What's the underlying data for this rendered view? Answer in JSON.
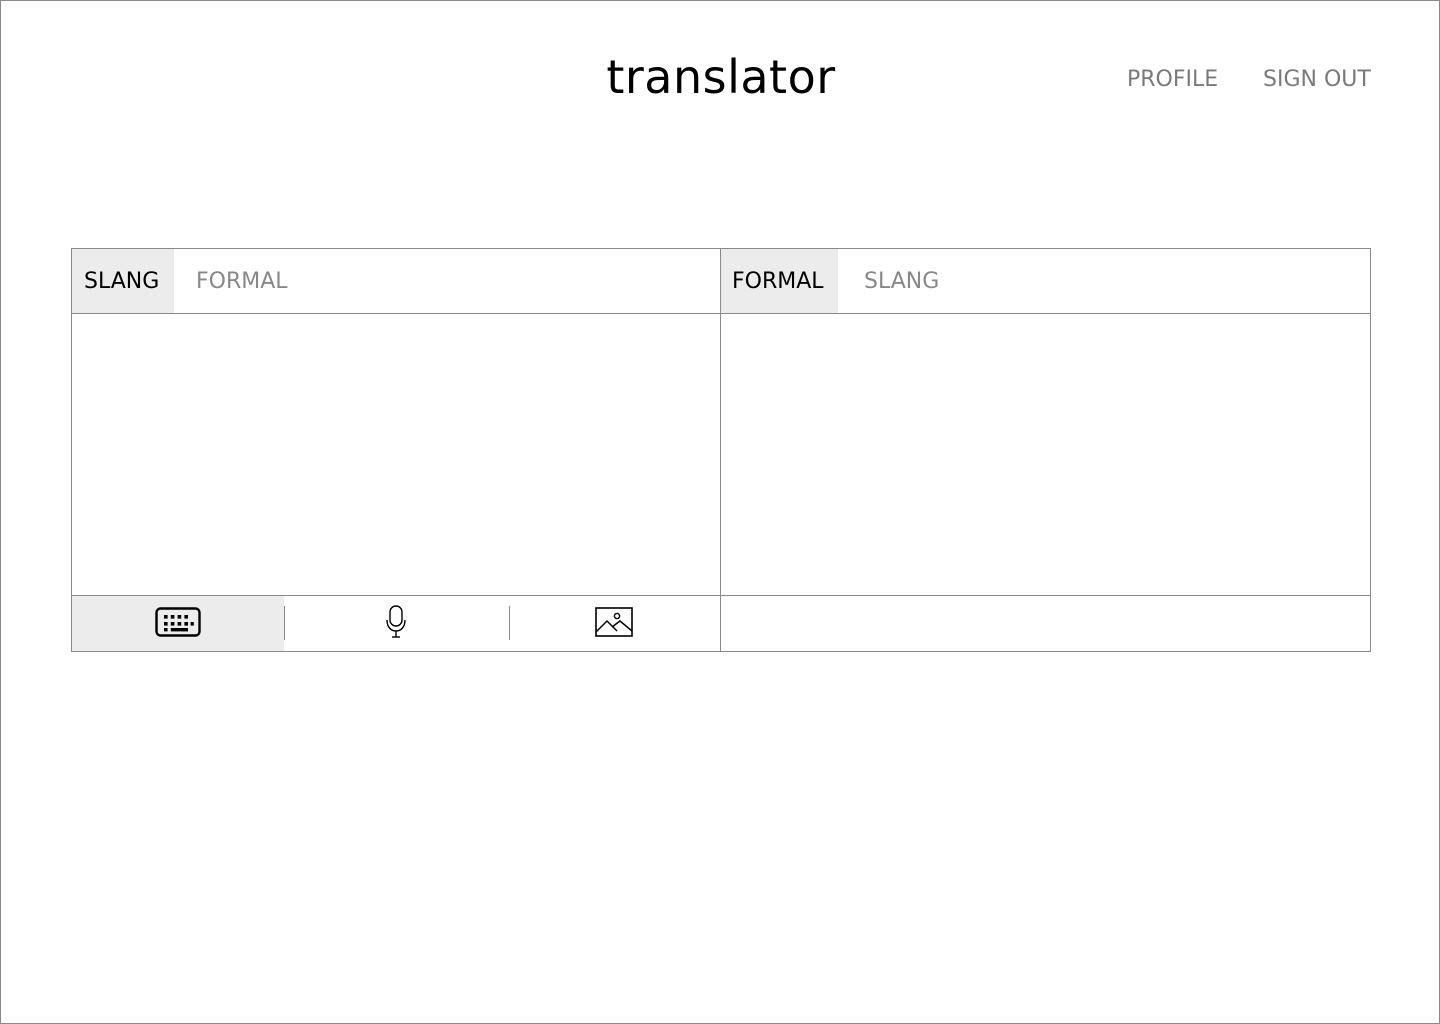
{
  "header": {
    "title": "translator",
    "nav": {
      "profile": "PROFILE",
      "sign_out": "SIGN OUT"
    }
  },
  "source": {
    "tabs": {
      "active": "SLANG",
      "inactive": "FORMAL"
    },
    "text_value": "",
    "input_modes": [
      {
        "name": "keyboard-icon",
        "selected": true
      },
      {
        "name": "microphone-icon",
        "selected": false
      },
      {
        "name": "image-icon",
        "selected": false
      }
    ]
  },
  "target": {
    "tabs": {
      "active": "FORMAL",
      "inactive": "SLANG"
    },
    "text_value": ""
  },
  "colors": {
    "border": "#8a8a8a",
    "active_tab_bg": "#ececec",
    "inactive_text": "#7a7a7a",
    "text": "#000000"
  }
}
